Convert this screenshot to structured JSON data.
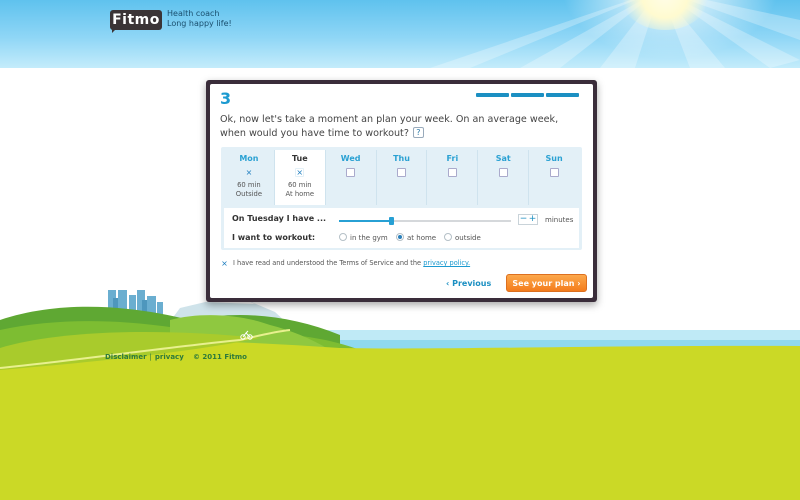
{
  "header": {
    "logo": "Fitmo",
    "tagline_line1": "Health coach",
    "tagline_line2": "Long happy life!"
  },
  "wizard": {
    "step": "3",
    "progress_segments_filled": 3,
    "question": "Ok, now let's take a moment an plan your week. On an average week, when would you have time to workout?",
    "help_label": "?",
    "days": [
      {
        "name": "Mon",
        "checked": true,
        "duration": "60 min",
        "location": "Outside"
      },
      {
        "name": "Tue",
        "checked": true,
        "duration": "60 min",
        "location": "At home",
        "active": true
      },
      {
        "name": "Wed",
        "checked": false
      },
      {
        "name": "Thu",
        "checked": false
      },
      {
        "name": "Fri",
        "checked": false
      },
      {
        "name": "Sat",
        "checked": false
      },
      {
        "name": "Sun",
        "checked": false
      }
    ],
    "check_mark": "×",
    "time_row_label": "On Tuesday I have ...",
    "time_slider_fraction": 0.3,
    "minus_label": "−",
    "plus_label": "+",
    "unit_label": "minutes",
    "location_row_label": "I want to workout:",
    "location_options": [
      "in the gym",
      "at home",
      "outside"
    ],
    "location_selected": "at home",
    "terms_text": "I have read and understood the Terms of Service and the",
    "terms_link": "privacy policy.",
    "terms_checked": true,
    "previous_label": "Previous",
    "next_label": "See your plan",
    "previous_icon": "chevron-left-icon",
    "next_icon": "chevron-right-icon"
  },
  "footer": {
    "disclaimer": "Disclaimer",
    "separator": "|",
    "privacy": "privacy",
    "copyright": "© 2011 Fitmo"
  },
  "colors": {
    "accent": "#1c9ad0",
    "button_orange": "#f47c1c",
    "frame": "#3a2d3a",
    "grass": "#cbd926",
    "sky": "#5fc2ee"
  }
}
